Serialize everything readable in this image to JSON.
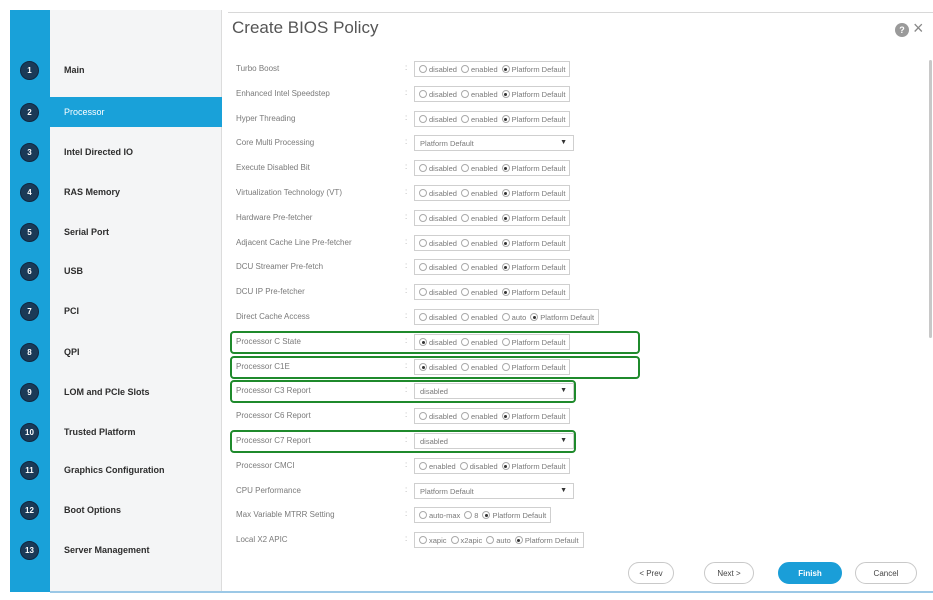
{
  "dialog": {
    "title": "Create BIOS Policy",
    "help_icon": "?",
    "close_icon": "×"
  },
  "steps": [
    {
      "number": "1",
      "label": "Main"
    },
    {
      "number": "2",
      "label": "Processor",
      "active": true
    },
    {
      "number": "3",
      "label": "Intel Directed IO"
    },
    {
      "number": "4",
      "label": "RAS Memory"
    },
    {
      "number": "5",
      "label": "Serial Port"
    },
    {
      "number": "6",
      "label": "USB"
    },
    {
      "number": "7",
      "label": "PCI"
    },
    {
      "number": "8",
      "label": "QPI"
    },
    {
      "number": "9",
      "label": "LOM and PCIe Slots"
    },
    {
      "number": "10",
      "label": "Trusted Platform"
    },
    {
      "number": "11",
      "label": "Graphics Configuration"
    },
    {
      "number": "12",
      "label": "Boot Options"
    },
    {
      "number": "13",
      "label": "Server Management"
    }
  ],
  "settings": [
    {
      "label": "Turbo Boost",
      "type": "radio",
      "options": [
        "disabled",
        "enabled",
        "Platform Default"
      ],
      "selected": 2
    },
    {
      "label": "Enhanced Intel Speedstep",
      "type": "radio",
      "options": [
        "disabled",
        "enabled",
        "Platform Default"
      ],
      "selected": 2
    },
    {
      "label": "Hyper Threading",
      "type": "radio",
      "options": [
        "disabled",
        "enabled",
        "Platform Default"
      ],
      "selected": 2
    },
    {
      "label": "Core Multi Processing",
      "type": "select",
      "value": "Platform Default"
    },
    {
      "label": "Execute Disabled Bit",
      "type": "radio",
      "options": [
        "disabled",
        "enabled",
        "Platform Default"
      ],
      "selected": 2
    },
    {
      "label": "Virtualization Technology (VT)",
      "type": "radio",
      "options": [
        "disabled",
        "enabled",
        "Platform Default"
      ],
      "selected": 2
    },
    {
      "label": "Hardware Pre-fetcher",
      "type": "radio",
      "options": [
        "disabled",
        "enabled",
        "Platform Default"
      ],
      "selected": 2
    },
    {
      "label": "Adjacent Cache Line Pre-fetcher",
      "type": "radio",
      "options": [
        "disabled",
        "enabled",
        "Platform Default"
      ],
      "selected": 2
    },
    {
      "label": "DCU Streamer Pre-fetch",
      "type": "radio",
      "options": [
        "disabled",
        "enabled",
        "Platform Default"
      ],
      "selected": 2
    },
    {
      "label": "DCU IP Pre-fetcher",
      "type": "radio",
      "options": [
        "disabled",
        "enabled",
        "Platform Default"
      ],
      "selected": 2
    },
    {
      "label": "Direct Cache Access",
      "type": "radio",
      "options": [
        "disabled",
        "enabled",
        "auto",
        "Platform Default"
      ],
      "selected": 3
    },
    {
      "label": "Processor C State",
      "type": "radio",
      "options": [
        "disabled",
        "enabled",
        "Platform Default"
      ],
      "selected": 0,
      "highlighted": true
    },
    {
      "label": "Processor C1E",
      "type": "radio",
      "options": [
        "disabled",
        "enabled",
        "Platform Default"
      ],
      "selected": 0,
      "highlighted": true
    },
    {
      "label": "Processor C3 Report",
      "type": "select",
      "value": "disabled",
      "highlighted": true
    },
    {
      "label": "Processor C6 Report",
      "type": "radio",
      "options": [
        "disabled",
        "enabled",
        "Platform Default"
      ],
      "selected": 2
    },
    {
      "label": "Processor C7 Report",
      "type": "select",
      "value": "disabled",
      "highlighted": true
    },
    {
      "label": "Processor CMCI",
      "type": "radio",
      "options": [
        "enabled",
        "disabled",
        "Platform Default"
      ],
      "selected": 2
    },
    {
      "label": "CPU Performance",
      "type": "select",
      "value": "Platform Default"
    },
    {
      "label": "Max Variable MTRR Setting",
      "type": "radio",
      "options": [
        "auto-max",
        "8",
        "Platform Default"
      ],
      "selected": 2
    },
    {
      "label": "Local X2 APIC",
      "type": "radio",
      "options": [
        "xapic",
        "x2apic",
        "auto",
        "Platform Default"
      ],
      "selected": 3
    }
  ],
  "footer": {
    "prev": "< Prev",
    "next": "Next >",
    "finish": "Finish",
    "cancel": "Cancel"
  },
  "colors": {
    "accent": "#19a1d9",
    "highlight_border": "#1f8a2c",
    "step_badge": "#1b3a57"
  }
}
